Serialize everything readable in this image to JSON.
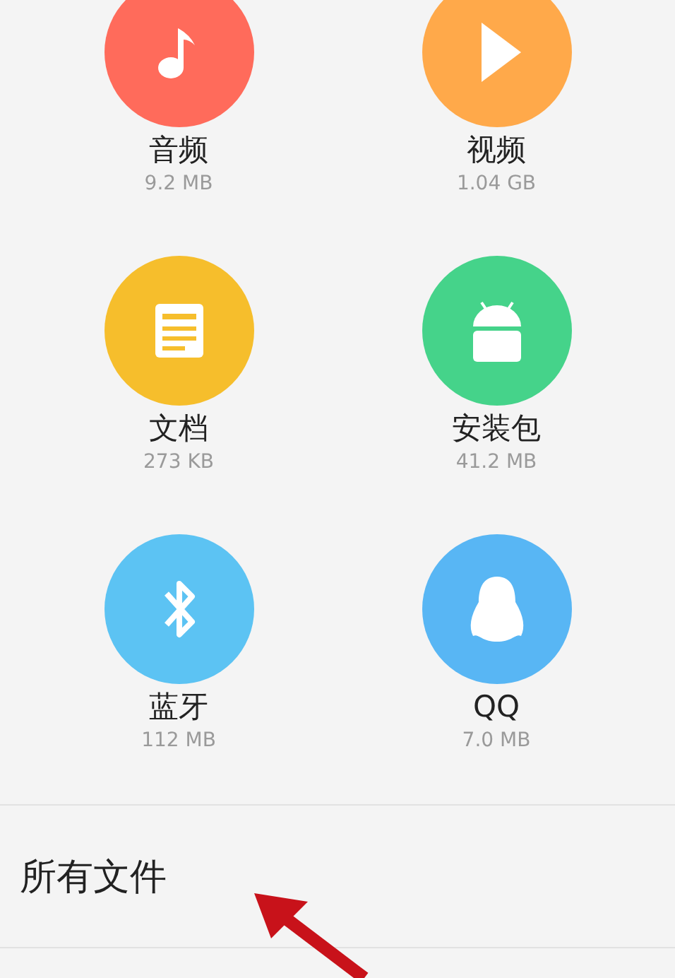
{
  "categories": [
    {
      "kind": "audio",
      "label": "音频",
      "size": "9.2 MB",
      "color": "#ff6b5b"
    },
    {
      "kind": "video",
      "label": "视频",
      "size": "1.04 GB",
      "color": "#ffa94a"
    },
    {
      "kind": "document",
      "label": "文档",
      "size": "273 KB",
      "color": "#f6be2c"
    },
    {
      "kind": "package",
      "label": "安装包",
      "size": "41.2 MB",
      "color": "#45d38a"
    },
    {
      "kind": "bluetooth",
      "label": "蓝牙",
      "size": "112 MB",
      "color": "#5cc3f3"
    },
    {
      "kind": "qq",
      "label": "QQ",
      "size": "7.0 MB",
      "color": "#58b6f4"
    }
  ],
  "all_files": {
    "label": "所有文件"
  }
}
